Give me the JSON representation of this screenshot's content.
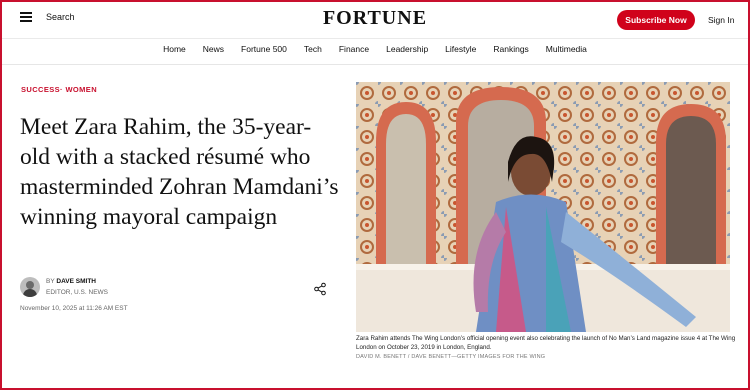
{
  "header": {
    "search_label": "Search",
    "logo": "FORTUNE",
    "subscribe_label": "Subscribe Now",
    "signin_label": "Sign In"
  },
  "nav": {
    "items": [
      "Home",
      "News",
      "Fortune 500",
      "Tech",
      "Finance",
      "Leadership",
      "Lifestyle",
      "Rankings",
      "Multimedia"
    ]
  },
  "article": {
    "category": "SUCCESS· WOMEN",
    "headline": "Meet Zara Rahim, the 35-year-old with a stacked résumé who masterminded Zohran Mamdani’s winning mayoral campaign",
    "byline_prefix": "BY",
    "author": "DAVE SMITH",
    "author_title": "EDITOR, U.S. NEWS",
    "date": "November 10, 2025 at 11:26 AM EST"
  },
  "photo": {
    "caption": "Zara Rahim attends The Wing London’s official opening event also celebrating the launch of No Man’s Land magazine issue 4 at The Wing London on October 23, 2019 in London, England.",
    "credit": "DAVID M. BENETT / DAVE BENETT—GETTY IMAGES FOR THE WING"
  },
  "colors": {
    "brand_red": "#d0021b",
    "category_red": "#c8102e"
  },
  "icons": [
    "menu-icon",
    "share-icon"
  ]
}
